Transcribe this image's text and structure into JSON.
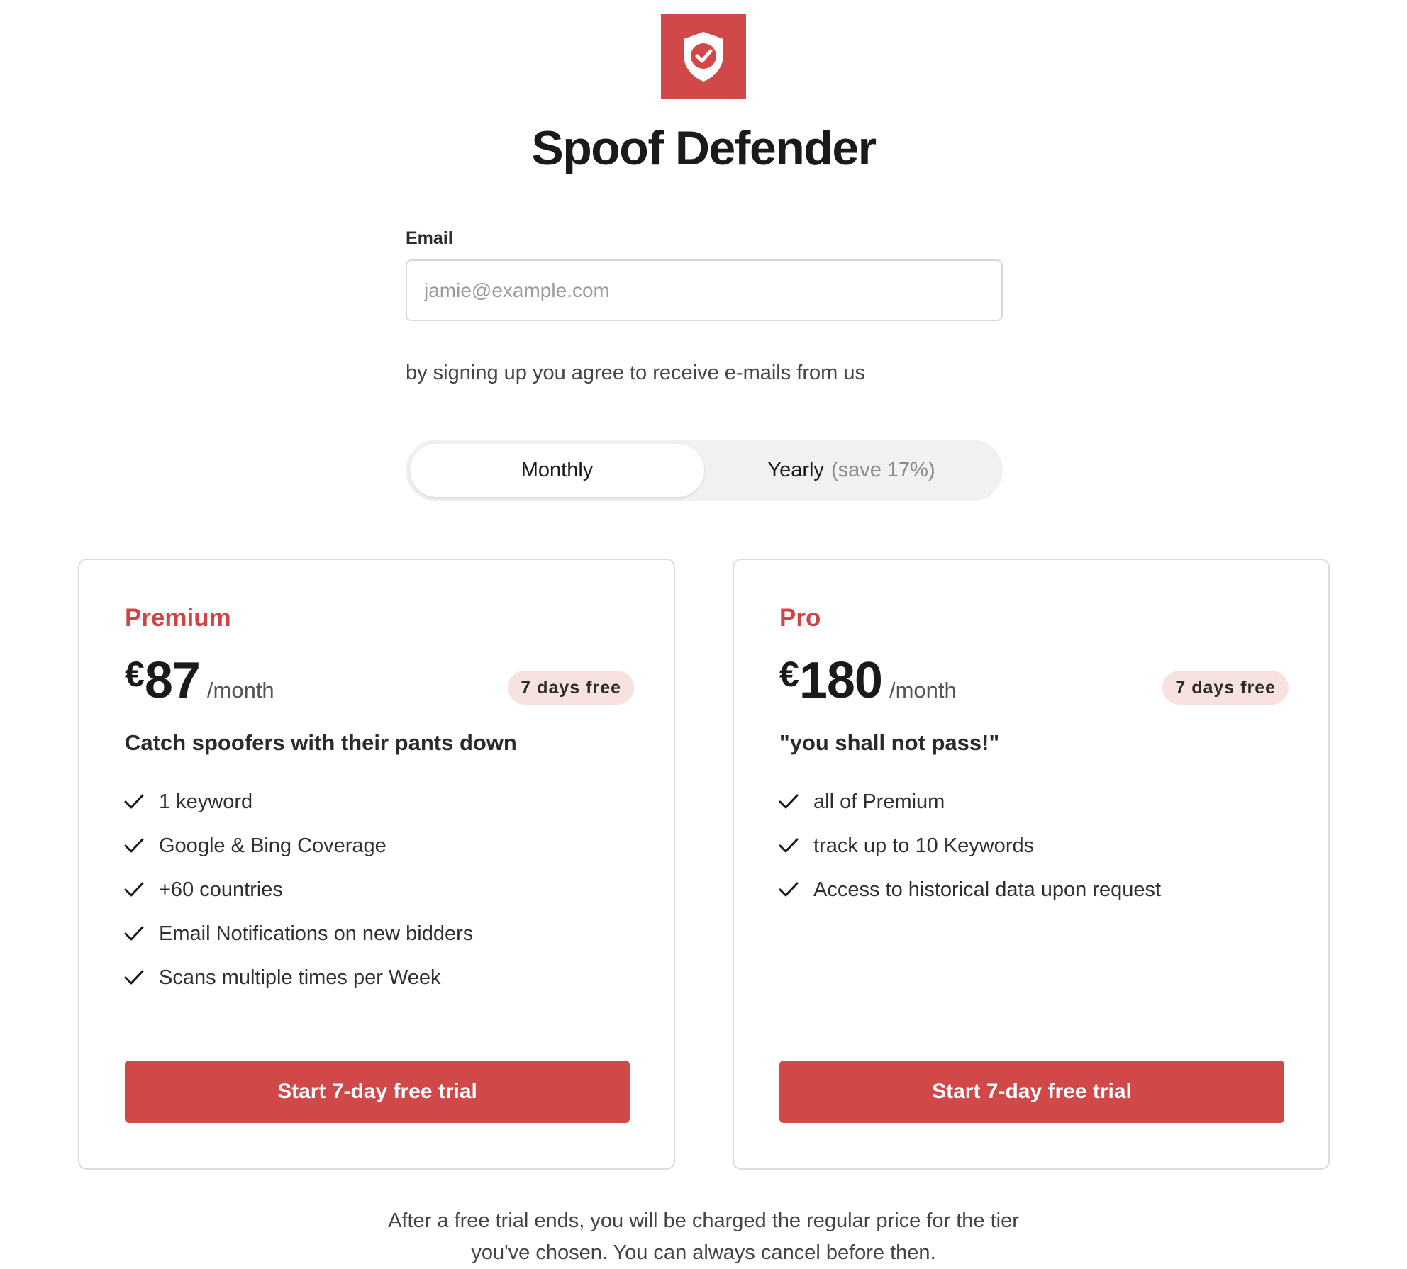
{
  "brand": {
    "logo_icon": "shield-check-icon",
    "accent_color": "#d04848",
    "title": "Spoof Defender"
  },
  "signup": {
    "email_label": "Email",
    "email_placeholder": "jamie@example.com",
    "email_value": "",
    "consent_text": "by signing up you agree to receive e-mails from us"
  },
  "billing_toggle": {
    "selected": "Monthly",
    "monthly_label": "Monthly",
    "yearly_label": "Yearly",
    "yearly_note": "(save 17%)"
  },
  "plans": [
    {
      "name": "Premium",
      "currency": "€",
      "price": "87",
      "period": "/month",
      "badge": "7 days free",
      "tagline": "Catch spoofers with their pants down",
      "features": [
        "1 keyword",
        "Google & Bing Coverage",
        "+60 countries",
        "Email Notifications on new bidders",
        "Scans multiple times per Week"
      ],
      "cta": "Start 7-day free trial"
    },
    {
      "name": "Pro",
      "currency": "€",
      "price": "180",
      "period": "/month",
      "badge": "7 days free",
      "tagline": "\"you shall not pass!\"",
      "features": [
        "all of Premium",
        "track up to 10 Keywords",
        "Access to historical data upon request"
      ],
      "cta": "Start 7-day free trial"
    }
  ],
  "footer": {
    "line1": "After a free trial ends, you will be charged the regular price for the tier",
    "line2": "you've chosen. You can always cancel before then."
  }
}
